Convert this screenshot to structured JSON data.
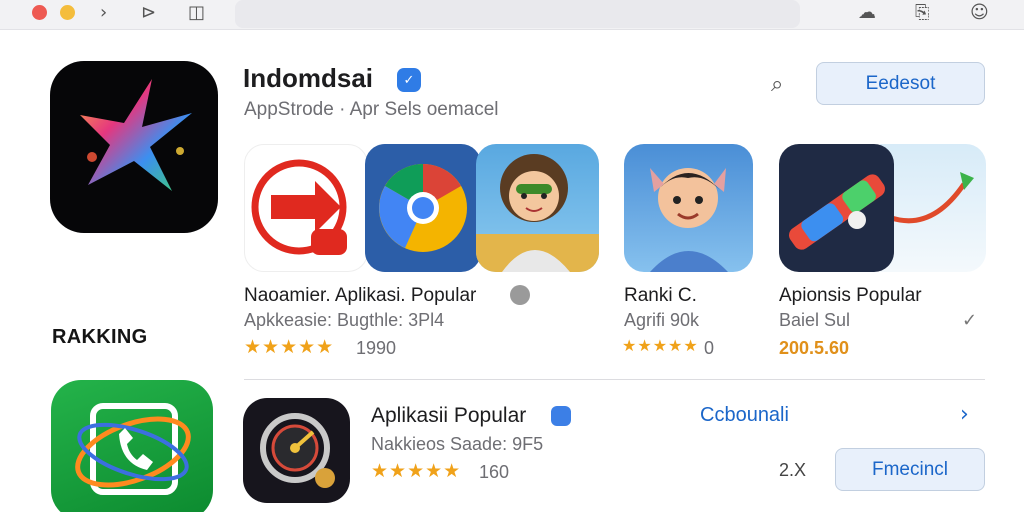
{
  "app": {
    "title": "Indomdsai",
    "subtitle": "AppStrode · Apr Sels oemacel",
    "verified_icon": "verified-badge-icon",
    "get_button": "Eedesot"
  },
  "section": {
    "ranking_label": "RAKKING"
  },
  "featured": [
    {
      "name": "Naoamier. Aplikasi. Popular",
      "sub": "Apkkeasie: Bugthle: 3Pl4",
      "stars": "★★★★★",
      "rating": "1990"
    },
    {
      "name": "Ranki C.",
      "sub": "Agrifi 90k",
      "stars": "★★★★★",
      "rating": "0"
    },
    {
      "name": "Apionsis Popular",
      "sub": "Baiel Sul",
      "stars": "",
      "rating": "200.5.60"
    }
  ],
  "list_item": {
    "name": "Aplikasii Popular",
    "sub": "Nakkieos Saade: 9F5",
    "stars": "★★★★★",
    "rating": "160",
    "link": "Ccbounali",
    "count": "2.X",
    "button": "Fmecincl"
  },
  "colors": {
    "accent": "#1b66c9",
    "star": "#f0a21a"
  }
}
